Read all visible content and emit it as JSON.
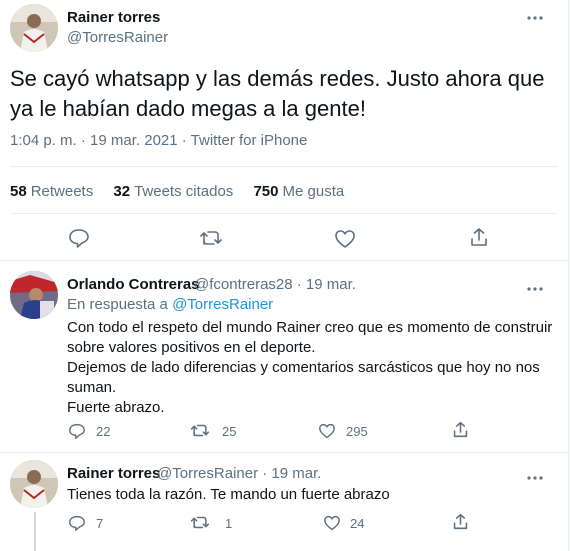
{
  "main_tweet": {
    "display_name": "Rainer torres",
    "handle": "@TorresRainer",
    "text": "Se cayó whatsapp y las demás redes. Justo ahora que ya le habían dado megas a la gente!",
    "timestamp": "1:04 p. m. · 19 mar. 2021 · Twitter for iPhone",
    "more_icon": "more-dots-icon",
    "stats": {
      "retweets_count": "58",
      "retweets_label": "Retweets",
      "quotes_count": "32",
      "quotes_label": "Tweets citados",
      "likes_count": "750",
      "likes_label": "Me gusta"
    },
    "actions": [
      "reply-icon",
      "retweet-icon",
      "like-icon",
      "share-icon"
    ]
  },
  "replies": [
    {
      "display_name": "Orlando Contreras",
      "meta": "@fcontreras28 · 19 mar.",
      "in_reply_prefix": "En respuesta a",
      "in_reply_handle": "@TorresRainer",
      "text": [
        "Con todo el respeto del mundo Rainer creo que es momento de construir",
        "sobre valores positivos en el deporte.",
        "Dejemos de lado diferencias y comentarios sarcásticos que hoy no nos",
        "suman.",
        "Fuerte abrazo."
      ],
      "reply_count": "22",
      "retweet_count": "25",
      "like_count": "295"
    },
    {
      "display_name": "Rainer torres",
      "meta": "@TorresRainer · 19 mar.",
      "text": [
        "Tienes toda la razón. Te mando un fuerte abrazo"
      ],
      "reply_count": "7",
      "retweet_count": "1",
      "like_count": "24"
    }
  ],
  "colors": {
    "secondary": "#5b7083",
    "link": "#1b95e0",
    "divider": "#e6ecf0",
    "text": "#0f1419"
  }
}
